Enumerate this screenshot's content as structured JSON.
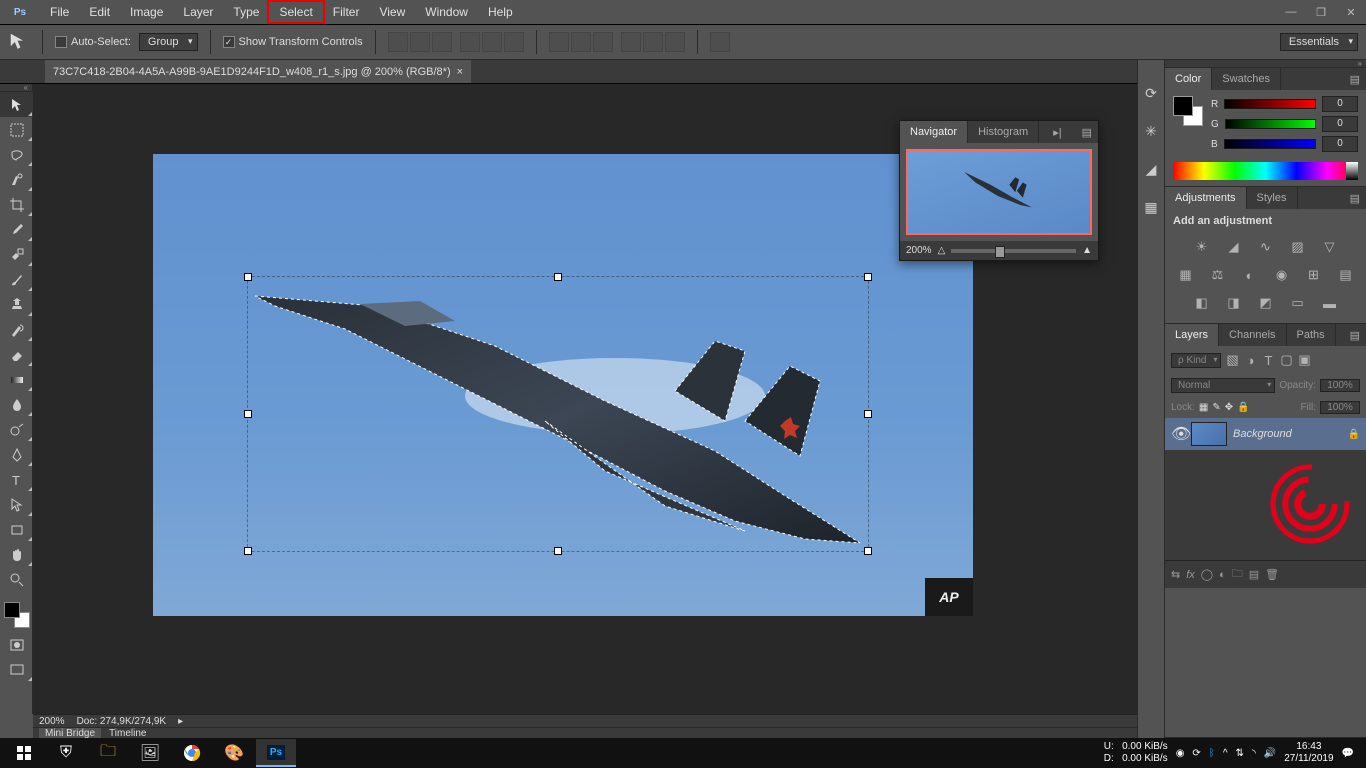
{
  "app": {
    "name": "Ps"
  },
  "menu": {
    "items": [
      "File",
      "Edit",
      "Image",
      "Layer",
      "Type",
      "Select",
      "Filter",
      "View",
      "Window",
      "Help"
    ],
    "highlighted": "Select"
  },
  "options": {
    "auto_select_label": "Auto-Select:",
    "group": "Group",
    "show_transform": "Show Transform Controls",
    "workspace": "Essentials"
  },
  "tab": {
    "title": "73C7C418-2B04-4A5A-A99B-9AE1D9244F1D_w408_r1_s.jpg @ 200% (RGB/8*)",
    "close": "×"
  },
  "navigator": {
    "tabs": [
      "Navigator",
      "Histogram"
    ],
    "zoom": "200%"
  },
  "color": {
    "tabs": [
      "Color",
      "Swatches"
    ],
    "channels": {
      "R": "0",
      "G": "0",
      "B": "0"
    }
  },
  "adjust": {
    "tabs": [
      "Adjustments",
      "Styles"
    ],
    "heading": "Add an adjustment"
  },
  "layers": {
    "tabs": [
      "Layers",
      "Channels",
      "Paths"
    ],
    "kind": "ρ Kind",
    "mode": "Normal",
    "opacity_label": "Opacity:",
    "opacity": "100%",
    "lock_label": "Lock:",
    "fill_label": "Fill:",
    "fill": "100%",
    "item": {
      "name": "Background"
    }
  },
  "status": {
    "zoom": "200%",
    "doc": "Doc: 274,9K/274,9K",
    "mini_bridge": "Mini Bridge",
    "timeline": "Timeline"
  },
  "taskbar": {
    "net": {
      "u_label": "U:",
      "u": "0.00 KiB/s",
      "d_label": "D:",
      "d": "0.00 KiB/s"
    },
    "time": "16:43",
    "date": "27/11/2019"
  },
  "ap": "AP"
}
